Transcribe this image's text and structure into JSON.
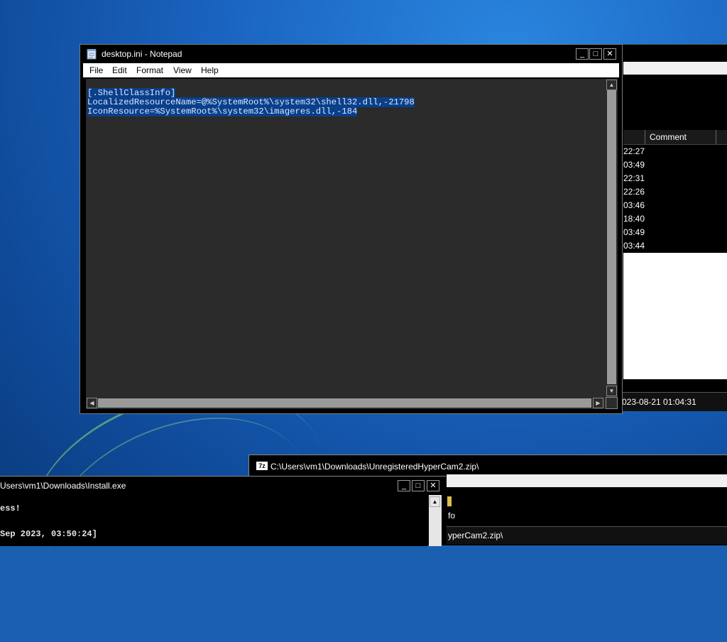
{
  "notepad": {
    "title": "desktop.ini - Notepad",
    "menu": [
      "File",
      "Edit",
      "Format",
      "View",
      "Help"
    ],
    "lines": [
      "[.ShellClassInfo]",
      "LocalizedResourceName=@%SystemRoot%\\system32\\shell32.dll,-21798",
      "IconResource=%SystemRoot%\\system32\\imageres.dll,-184"
    ],
    "controls": {
      "minimize": "_",
      "maximize": "□",
      "close": "✕"
    }
  },
  "archive_window": {
    "column_header": "Comment",
    "rows": [
      "22:27",
      "03:49",
      "22:31",
      "22:26",
      "03:46",
      "18:40",
      "03:49",
      "03:44"
    ],
    "status": "023-08-21 01:04:31"
  },
  "archive_window_2": {
    "title": "C:\\Users\\vm1\\Downloads\\UnregisteredHyperCam2.zip\\",
    "icon_label": "7z",
    "folder_text": "fo",
    "path_text": "yperCam2.zip\\"
  },
  "console": {
    "title": "Users\\vm1\\Downloads\\Install.exe",
    "lines": [
      "ess!",
      "Sep 2023, 03:50:24]"
    ],
    "controls": {
      "minimize": "_",
      "maximize": "□",
      "close": "✕"
    }
  }
}
